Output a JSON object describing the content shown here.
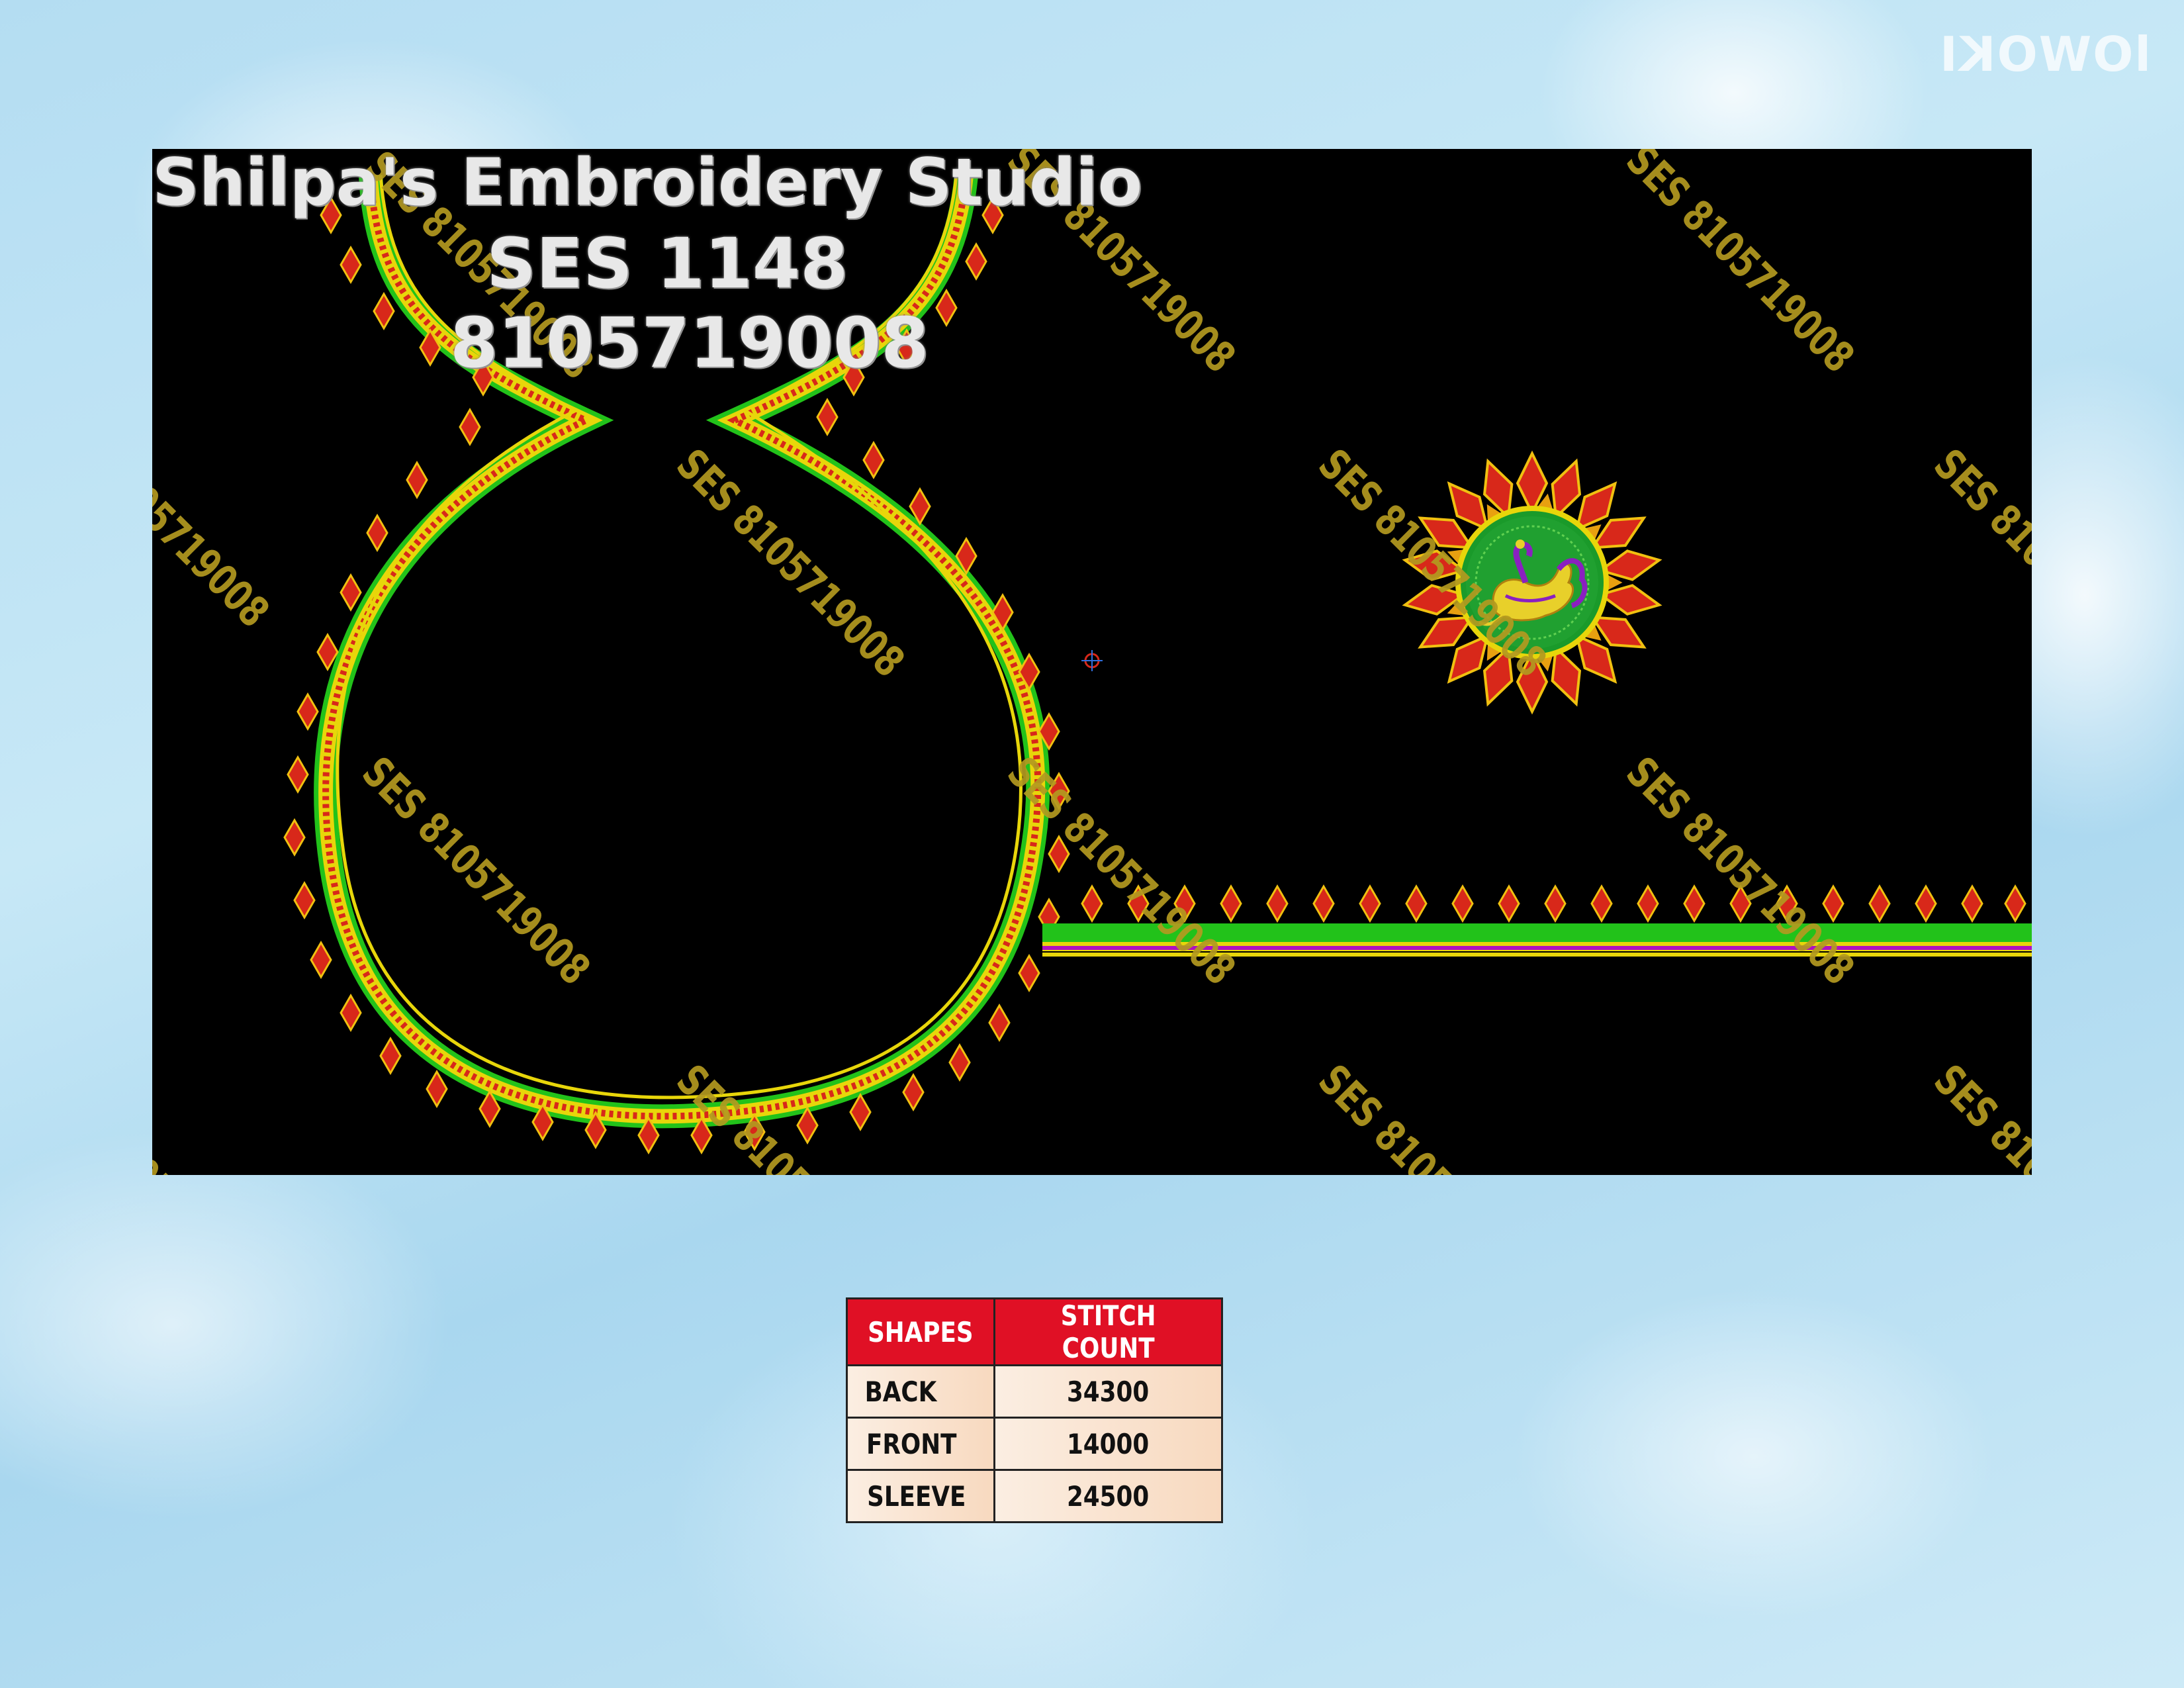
{
  "design": {
    "studio_name": "Shilpa's Embroidery Studio",
    "design_code": "SES 1148",
    "phone": "8105719008",
    "watermark_text": "SES 8105719008",
    "corner_logo": "lOWOKI"
  },
  "colors": {
    "background": "#000000",
    "border_green": "#22c21a",
    "border_yellow": "#e8d60a",
    "petal_red": "#d8281a",
    "table_header": "#e01025",
    "watermark": "#b39a20"
  },
  "stitch_table": {
    "headers": [
      "SHAPES",
      "STITCH COUNT"
    ],
    "rows": [
      {
        "shape": "BACK",
        "count": "34300"
      },
      {
        "shape": "FRONT",
        "count": "14000"
      },
      {
        "shape": "SLEEVE",
        "count": "24500"
      }
    ]
  }
}
